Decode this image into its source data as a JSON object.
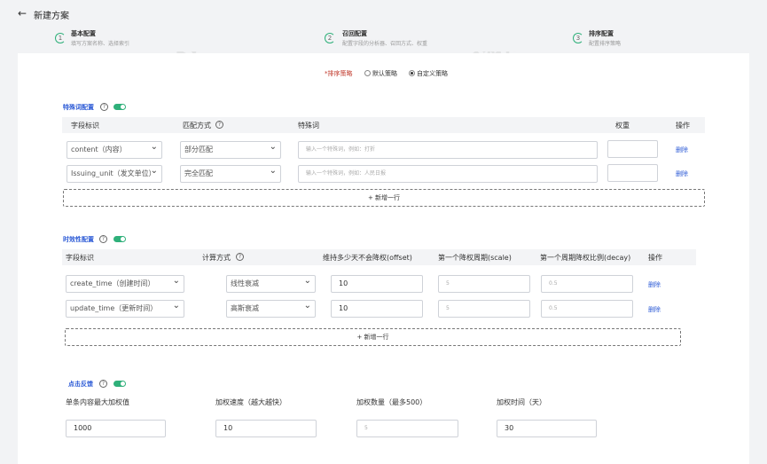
{
  "header": {
    "back_icon": "arrow-left-icon",
    "title": "新建方案"
  },
  "steps": [
    {
      "num": "1",
      "title": "基本配置",
      "sub": "填写方案名称、选择索引"
    },
    {
      "num": "2",
      "title": "召回配置",
      "sub": "配置字段的分析器、召回方式、权重"
    },
    {
      "num": "3",
      "title": "排序配置",
      "sub": "配置排序策略"
    }
  ],
  "strategy": {
    "label": "*排序策略",
    "opt_default": "默认策略",
    "opt_custom": "自定义策略",
    "selected": "自定义策略"
  },
  "special": {
    "title": "特殊词配置",
    "cols": {
      "field": "字段标识",
      "match": "匹配方式",
      "word": "特殊词",
      "weight": "权重",
      "op": "操作"
    },
    "rows": [
      {
        "field": "content（内容）",
        "match": "部分匹配",
        "word_ph": "输入一个特殊词，例如：打折",
        "del": "删除"
      },
      {
        "field": "Issuing_unit（发文单位）",
        "match": "完全匹配",
        "word_ph": "输入一个特殊词，例如：人民日报",
        "del": "删除"
      }
    ],
    "add": "+ 新增一行"
  },
  "timeliness": {
    "title": "时效性配置",
    "cols": {
      "field": "字段标识",
      "calc": "计算方式",
      "offset": "维持多少天不会降权(offset)",
      "scale": "第一个降权周期(scale)",
      "decay": "第一个周期降权比例(decay)",
      "op": "操作"
    },
    "rows": [
      {
        "field": "create_time（创建时间）",
        "calc": "线性衰减",
        "offset": "10",
        "scale_ph": "5",
        "decay_ph": "0.5",
        "del": "删除"
      },
      {
        "field": "update_time（更新时间）",
        "calc": "高斯衰减",
        "offset": "10",
        "scale_ph": "5",
        "decay_ph": "0.5",
        "del": "删除"
      }
    ],
    "add": "+ 新增一行"
  },
  "click": {
    "title": "点击反馈",
    "cols": {
      "max": "单条内容最大加权值",
      "speed": "加权速度（越大越快）",
      "count": "加权数量（最多500）",
      "time": "加权时间（天）"
    },
    "values": {
      "max": "1000",
      "speed": "10",
      "count_ph": "5",
      "time": "30"
    }
  },
  "colors": {
    "accent": "#2fb07a",
    "link": "#2d5bd6"
  }
}
